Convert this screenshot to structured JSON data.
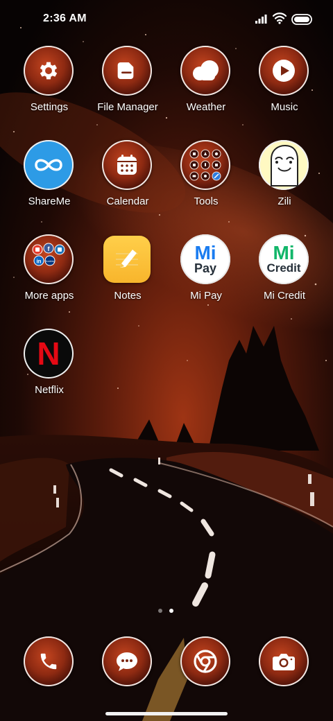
{
  "status_bar": {
    "time": "2:36 AM",
    "signal_icon": "signal-bars-icon",
    "wifi_icon": "wifi-icon",
    "battery_icon": "battery-icon"
  },
  "apps": [
    {
      "label": "Settings",
      "icon": "gear-icon"
    },
    {
      "label": "File Manager",
      "icon": "folder-icon"
    },
    {
      "label": "Weather",
      "icon": "cloud-icon"
    },
    {
      "label": "Music",
      "icon": "play-icon"
    },
    {
      "label": "ShareMe",
      "icon": "infinity-icon"
    },
    {
      "label": "Calendar",
      "icon": "calendar-icon"
    },
    {
      "label": "Tools",
      "icon": "tools-folder-icon"
    },
    {
      "label": "Zili",
      "icon": "zili-face-icon"
    },
    {
      "label": "More apps",
      "icon": "apps-folder-icon"
    },
    {
      "label": "Notes",
      "icon": "notes-pencil-icon"
    },
    {
      "label": "Mi Pay",
      "icon": "mi-pay-logo",
      "logo_text": "Pay"
    },
    {
      "label": "Mi Credit",
      "icon": "mi-credit-logo",
      "logo_text": "Credit"
    },
    {
      "label": "Netflix",
      "icon": "netflix-logo"
    }
  ],
  "mi_logo_text": "Mi",
  "netflix_logo_text": "N",
  "more_apps_mini_labels": [
    "f",
    "in",
    "Booking"
  ],
  "page_indicator": {
    "count": 2,
    "active_index": 1
  },
  "dock": [
    {
      "icon": "phone-icon"
    },
    {
      "icon": "chat-bubble-icon"
    },
    {
      "icon": "chrome-icon"
    },
    {
      "icon": "camera-icon"
    }
  ],
  "colors": {
    "accent": "#c2441f",
    "mi_blue": "#1a7cf0",
    "mi_green": "#12b66a",
    "netflix_red": "#e50914",
    "notes_yellow": "#f8b52c",
    "shareme_blue": "#2d9be6"
  }
}
